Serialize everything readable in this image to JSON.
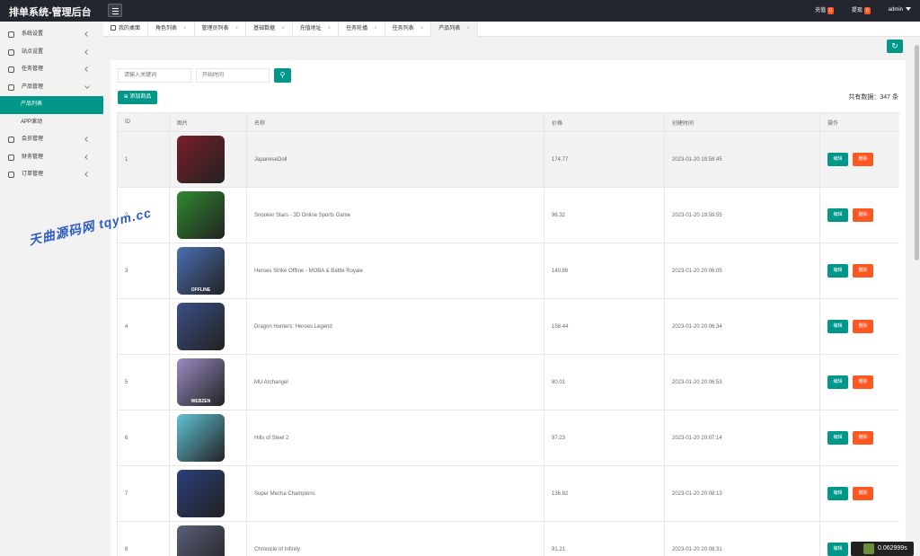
{
  "app": {
    "title": "排单系统-管理后台"
  },
  "top": {
    "recharge": {
      "label": "充值",
      "badge": "0"
    },
    "withdraw": {
      "label": "提现",
      "badge": "0"
    },
    "user": "admin"
  },
  "sidebar": {
    "items": [
      {
        "label": "系统设置"
      },
      {
        "label": "站点设置"
      },
      {
        "label": "任务管理"
      },
      {
        "label": "产品管理"
      },
      {
        "label": "会员管理"
      },
      {
        "label": "财务管理"
      },
      {
        "label": "订单管理"
      }
    ],
    "sub": [
      {
        "label": "产品列表"
      },
      {
        "label": "APP滚动"
      }
    ]
  },
  "tabs": [
    {
      "label": "我的桌面"
    },
    {
      "label": "角色列表"
    },
    {
      "label": "管理员列表"
    },
    {
      "label": "基础数据"
    },
    {
      "label": "充值地址"
    },
    {
      "label": "任务轮播"
    },
    {
      "label": "任务列表"
    },
    {
      "label": "产品列表"
    }
  ],
  "tab_close": "×",
  "search": {
    "keyword_placeholder": "请输入关键词",
    "time_placeholder": "开始时间",
    "button_icon": "search-icon"
  },
  "actions": {
    "add_label": "添加商品",
    "total_label": "共有数据：347 条",
    "refresh_icon": "refresh-icon"
  },
  "table": {
    "headers": [
      "ID",
      "图片",
      "名称",
      "价格",
      "创建时间",
      "操作"
    ],
    "edit_label": "编辑",
    "delete_label": "删除",
    "rows": [
      {
        "id": "1",
        "name": "JapaneseDoll",
        "price": "174.77",
        "created": "2023-01-20 19:58:45",
        "thumb_color": "#7a1e28"
      },
      {
        "id": "2",
        "name": "Snooker Stars - 3D Online Sports Game",
        "price": "96.32",
        "created": "2023-01-20 19:59:55",
        "thumb_color": "#2f8a2f"
      },
      {
        "id": "3",
        "name": "Heroes Strike Offline - MOBA & Battle Royale",
        "price": "140.86",
        "created": "2023-01-20 20:06:05",
        "thumb_color": "#4a6fb3",
        "thumb_text": "OFFLINE"
      },
      {
        "id": "4",
        "name": "Dragon Hunters: Heroes Legend",
        "price": "158.44",
        "created": "2023-01-20 20:06:34",
        "thumb_color": "#3b4f86"
      },
      {
        "id": "5",
        "name": "MU Archangel",
        "price": "80.01",
        "created": "2023-01-20 20:06:53",
        "thumb_color": "#9a8cc4",
        "thumb_text": "WEBZEN"
      },
      {
        "id": "6",
        "name": "Hills of Steel 2",
        "price": "97.23",
        "created": "2023-01-20 20:07:14",
        "thumb_color": "#5fc2d6"
      },
      {
        "id": "7",
        "name": "Super Mecha Champions",
        "price": "136.82",
        "created": "2023-01-20 20:08:13",
        "thumb_color": "#2b3f7a"
      },
      {
        "id": "8",
        "name": "Chronicle of Infinity",
        "price": "91.21",
        "created": "2023-01-20 20:08:31",
        "thumb_color": "#5a5f78"
      }
    ]
  },
  "watermark": "天曲源码网 tqym.cc",
  "timer": "0.062999s"
}
